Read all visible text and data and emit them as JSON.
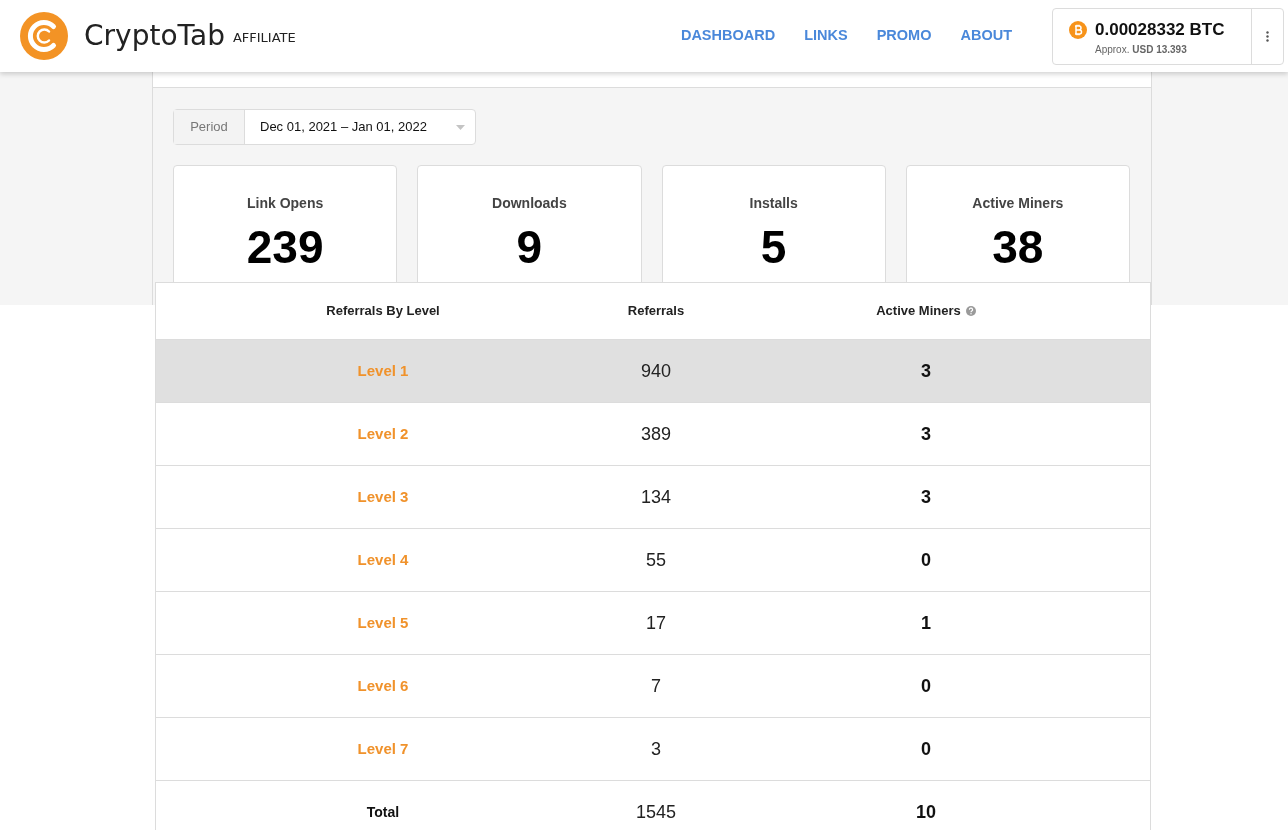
{
  "header": {
    "logo": {
      "name": "CryptoTab",
      "tag": "AFFILIATE"
    },
    "nav": [
      "DASHBOARD",
      "LINKS",
      "PROMO",
      "ABOUT"
    ],
    "balance": {
      "amount": "0.00028332 BTC",
      "approx": "Approx. **USD 13.393**"
    }
  },
  "page": {
    "period": {
      "label": "Period",
      "value": "Dec 01, 2021 – Jan 01, 2022"
    },
    "stats": [
      {
        "label": "Link Opens",
        "value": "239"
      },
      {
        "label": "Downloads",
        "value": "9"
      },
      {
        "label": "Installs",
        "value": "5"
      },
      {
        "label": "Active Miners",
        "value": "38"
      }
    ]
  },
  "table": {
    "columns": [
      "Referrals By Level",
      "Referrals",
      "Active Miners"
    ],
    "rows": [
      {
        "level": "Level 1",
        "referrals": "940",
        "active_miners": "3",
        "highlighted": true
      },
      {
        "level": "Level 2",
        "referrals": "389",
        "active_miners": "3",
        "highlighted": false
      },
      {
        "level": "Level 3",
        "referrals": "134",
        "active_miners": "3",
        "highlighted": false
      },
      {
        "level": "Level 4",
        "referrals": "55",
        "active_miners": "0",
        "highlighted": false
      },
      {
        "level": "Level 5",
        "referrals": "17",
        "active_miners": "1",
        "highlighted": false
      },
      {
        "level": "Level 6",
        "referrals": "7",
        "active_miners": "0",
        "highlighted": false
      },
      {
        "level": "Level 7",
        "referrals": "3",
        "active_miners": "0",
        "highlighted": false
      }
    ],
    "total": {
      "label": "Total",
      "referrals": "1545",
      "active_miners": "10"
    }
  }
}
